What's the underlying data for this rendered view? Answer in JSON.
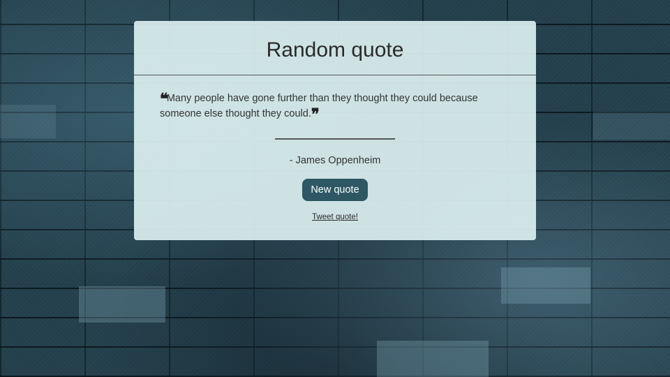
{
  "header": {
    "title": "Random quote"
  },
  "quote": {
    "open_icon": "quote-left-icon",
    "close_icon": "quote-right-icon",
    "text": "Many people have gone further than they thought they could because someone else thought they could.",
    "author": "- James Oppenheim"
  },
  "actions": {
    "new_quote_label": "New quote",
    "tweet_label": "Tweet quote!"
  },
  "colors": {
    "button": "#2e5764",
    "card": "#dcf0f0"
  }
}
